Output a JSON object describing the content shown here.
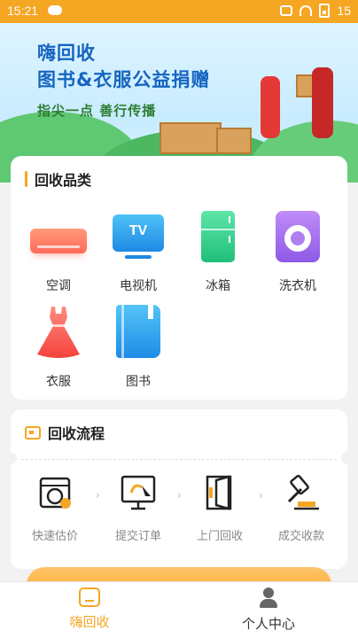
{
  "status_bar": {
    "time": "15:21",
    "battery": "15"
  },
  "banner": {
    "title_line1": "嗨回收",
    "title_line2": "图书&衣服公益捐赠",
    "slogan": "指尖一点  善行传播"
  },
  "categories_section": {
    "title": "回收品类",
    "items": [
      {
        "label": "空调",
        "icon": "air-conditioner-icon"
      },
      {
        "label": "电视机",
        "icon": "tv-icon",
        "icon_text": "TV"
      },
      {
        "label": "冰箱",
        "icon": "fridge-icon"
      },
      {
        "label": "洗衣机",
        "icon": "washing-machine-icon"
      },
      {
        "label": "衣服",
        "icon": "dress-icon"
      },
      {
        "label": "图书",
        "icon": "book-icon"
      }
    ]
  },
  "process_section": {
    "title": "回收流程",
    "steps": [
      {
        "label": "快速估价",
        "icon": "appraisal-icon"
      },
      {
        "label": "提交订单",
        "icon": "submit-order-icon"
      },
      {
        "label": "上门回收",
        "icon": "door-pickup-icon"
      },
      {
        "label": "成交收款",
        "icon": "deal-gavel-icon"
      }
    ]
  },
  "tab_bar": {
    "tabs": [
      {
        "label": "嗨回收",
        "active": true
      },
      {
        "label": "个人中心",
        "active": false
      }
    ]
  },
  "colors": {
    "accent": "#f5a623",
    "banner_title": "#1565c0",
    "slogan": "#2e7d32"
  }
}
